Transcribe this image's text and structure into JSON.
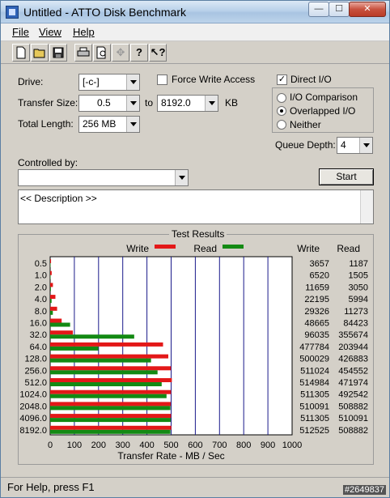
{
  "window": {
    "title": "Untitled - ATTO Disk Benchmark"
  },
  "menu": [
    "File",
    "View",
    "Help"
  ],
  "toolbar": [
    "new-icon",
    "open-icon",
    "save-icon",
    "print-icon",
    "print-preview-icon",
    "move-icon",
    "help-icon",
    "context-help-icon"
  ],
  "settings": {
    "drive_label": "Drive:",
    "drive_value": "[-c-]",
    "transfer_size_label": "Transfer Size:",
    "transfer_from": "0.5",
    "to_label": "to",
    "transfer_to": "8192.0",
    "kb_label": "KB",
    "total_length_label": "Total Length:",
    "total_length_value": "256 MB",
    "force_write_label": "Force Write Access",
    "force_write_checked": false,
    "direct_io_label": "Direct I/O",
    "direct_io_checked": true,
    "io_comparison_label": "I/O Comparison",
    "overlapped_io_label": "Overlapped I/O",
    "neither_label": "Neither",
    "selected_mode": "Overlapped I/O",
    "queue_depth_label": "Queue Depth:",
    "queue_depth_value": "4",
    "controlled_by_label": "Controlled by:",
    "controlled_by_value": "",
    "start_label": "Start",
    "description": "<< Description >>"
  },
  "chart_data": {
    "type": "bar",
    "title": "Test Results",
    "xlabel": "Transfer Rate - MB / Sec",
    "xlim": [
      0,
      1000
    ],
    "xticks": [
      "0",
      "100",
      "200",
      "300",
      "400",
      "500",
      "600",
      "700",
      "800",
      "900",
      "1000"
    ],
    "legend": {
      "write": "Write",
      "read": "Read",
      "write_color": "#e31818",
      "read_color": "#138a13"
    },
    "col_headers": {
      "write": "Write",
      "read": "Read"
    },
    "categories": [
      "0.5",
      "1.0",
      "2.0",
      "4.0",
      "8.0",
      "16.0",
      "32.0",
      "64.0",
      "128.0",
      "256.0",
      "512.0",
      "1024.0",
      "2048.0",
      "4096.0",
      "8192.0"
    ],
    "write_kb": [
      3657,
      6520,
      11659,
      22195,
      29326,
      48665,
      96035,
      477784,
      500029,
      511024,
      514984,
      511305,
      510091,
      511305,
      512525
    ],
    "read_kb": [
      1187,
      1505,
      3050,
      5994,
      11273,
      84423,
      355674,
      203944,
      426883,
      454552,
      471974,
      492542,
      508882,
      510091,
      508882
    ]
  },
  "status": {
    "text": "For Help, press F1",
    "id_badge": "#2649837"
  }
}
